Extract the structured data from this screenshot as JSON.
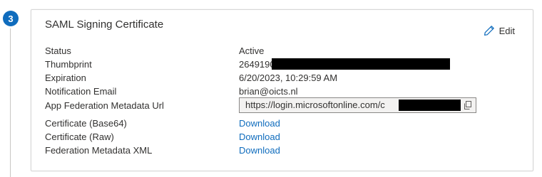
{
  "step": {
    "number": "3"
  },
  "card": {
    "title": "SAML Signing Certificate",
    "edit_label": "Edit"
  },
  "fields": {
    "status": {
      "label": "Status",
      "value": "Active"
    },
    "thumbprint": {
      "label": "Thumbprint",
      "value": "2649190"
    },
    "expiration": {
      "label": "Expiration",
      "value": "6/20/2023, 10:29:59 AM"
    },
    "notification_email": {
      "label": "Notification Email",
      "value": "brian@oicts.nl"
    },
    "metadata_url": {
      "label": "App Federation Metadata Url",
      "value": "https://login.microsoftonline.com/c"
    },
    "cert_base64": {
      "label": "Certificate (Base64)",
      "value": "Download"
    },
    "cert_raw": {
      "label": "Certificate (Raw)",
      "value": "Download"
    },
    "federation_xml": {
      "label": "Federation Metadata XML",
      "value": "Download"
    }
  },
  "icons": {
    "edit": "pencil-icon",
    "copy": "copy-icon"
  },
  "colors": {
    "accent": "#0f6cbd",
    "redaction": "#000000"
  }
}
